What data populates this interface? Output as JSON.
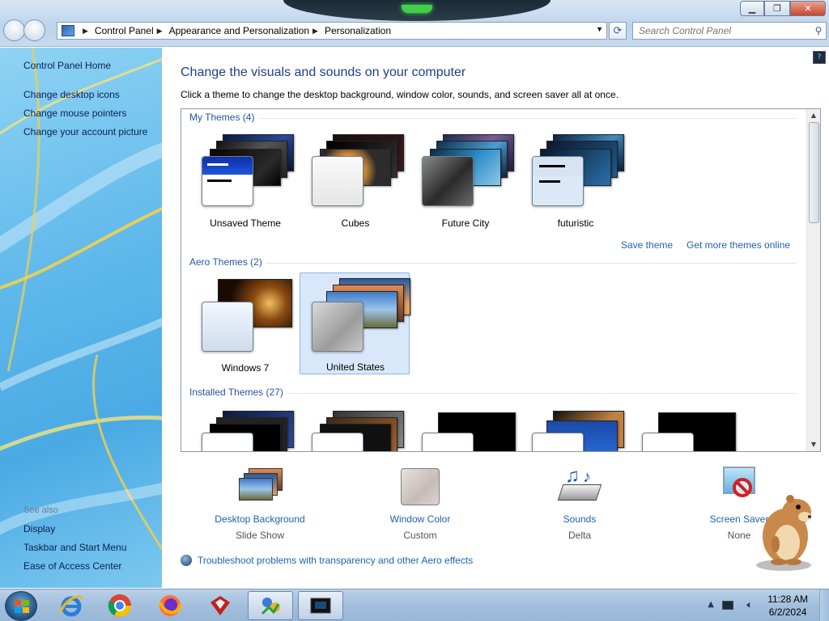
{
  "window": {
    "min": "▁",
    "max": "❐",
    "close": "✕"
  },
  "address": {
    "crumbs": [
      "Control Panel",
      "Appearance and Personalization",
      "Personalization"
    ]
  },
  "search": {
    "placeholder": "Search Control Panel"
  },
  "sidebar": {
    "home": "Control Panel Home",
    "links": [
      "Change desktop icons",
      "Change mouse pointers",
      "Change your account picture"
    ],
    "see_also": "See also",
    "see_also_links": [
      "Display",
      "Taskbar and Start Menu",
      "Ease of Access Center"
    ]
  },
  "main": {
    "title": "Change the visuals and sounds on your computer",
    "subtitle": "Click a theme to change the desktop background, window color, sounds, and screen saver all at once.",
    "groups": {
      "my": "My Themes (4)",
      "aero": "Aero Themes (2)",
      "installed": "Installed Themes (27)"
    },
    "my_themes": [
      "Unsaved Theme",
      "Cubes",
      "Future City",
      "futuristic"
    ],
    "aero_themes": [
      "Windows 7",
      "United States"
    ],
    "selected_theme": "United States",
    "save_theme": "Save theme",
    "get_more": "Get more themes online"
  },
  "bottom": [
    {
      "title": "Desktop Background",
      "value": "Slide Show"
    },
    {
      "title": "Window Color",
      "value": "Custom"
    },
    {
      "title": "Sounds",
      "value": "Delta"
    },
    {
      "title": "Screen Saver",
      "value": "None"
    }
  ],
  "troubleshoot": "Troubleshoot problems with transparency and other Aero effects",
  "clock": {
    "time": "11:28 AM",
    "date": "6/2/2024"
  },
  "colors": {
    "link": "#1e62b0",
    "heading": "#1e3f8a",
    "selection": "#d8e8fa"
  }
}
